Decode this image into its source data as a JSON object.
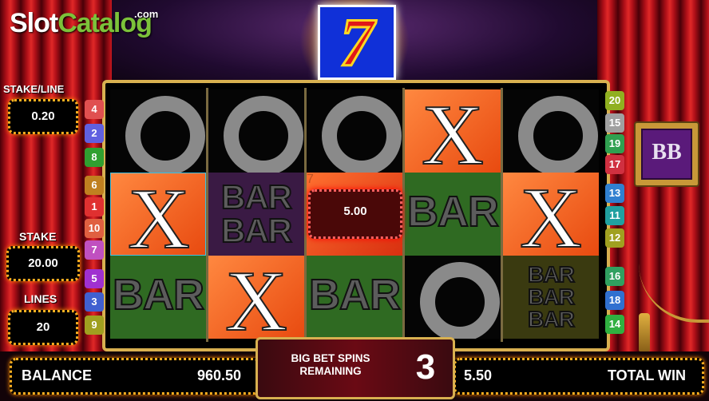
{
  "logo": {
    "part1": "Slot",
    "part2": "Catalog",
    "suffix": ".com"
  },
  "top_symbol": "7",
  "reels": [
    [
      "O",
      "X",
      "BAR"
    ],
    [
      "O",
      "BAR BAR",
      "X"
    ],
    [
      "O",
      "7",
      "BAR"
    ],
    [
      "X",
      "BAR",
      "O"
    ],
    [
      "O",
      "X",
      "BAR BAR BAR"
    ]
  ],
  "win_value": "5.00",
  "stake_line": {
    "label": "STAKE/LINE",
    "value": "0.20"
  },
  "stake": {
    "label": "STAKE",
    "value": "20.00"
  },
  "lines": {
    "label": "LINES",
    "value": "20"
  },
  "left_badges": [
    {
      "num": "4",
      "color": "#e05050"
    },
    {
      "num": "2",
      "color": "#6060e0"
    },
    {
      "num": "8",
      "color": "#30a030"
    },
    {
      "num": "6",
      "color": "#c08020"
    },
    {
      "num": "1",
      "color": "#e03030"
    },
    {
      "num": "10",
      "color": "#e06040"
    },
    {
      "num": "7",
      "color": "#c050c0"
    },
    {
      "num": "5",
      "color": "#a030d0"
    },
    {
      "num": "3",
      "color": "#4060d0"
    },
    {
      "num": "9",
      "color": "#a0a020"
    }
  ],
  "right_badges": [
    {
      "num": "20",
      "color": "#90b020"
    },
    {
      "num": "15",
      "color": "#a0a0a0"
    },
    {
      "num": "19",
      "color": "#30a050"
    },
    {
      "num": "17",
      "color": "#d03040"
    },
    {
      "num": "13",
      "color": "#3080d0"
    },
    {
      "num": "11",
      "color": "#20a0a0"
    },
    {
      "num": "12",
      "color": "#a0a020"
    },
    {
      "num": "16",
      "color": "#30a060"
    },
    {
      "num": "18",
      "color": "#3070d0"
    },
    {
      "num": "14",
      "color": "#30b040"
    }
  ],
  "balance": {
    "label": "BALANCE",
    "value": "960.50"
  },
  "big_bet": {
    "label": "BIG BET SPINS REMAINING",
    "count": "3"
  },
  "total_win": {
    "label": "TOTAL WIN",
    "value": "5.50"
  },
  "big_bet_logo": "BB"
}
